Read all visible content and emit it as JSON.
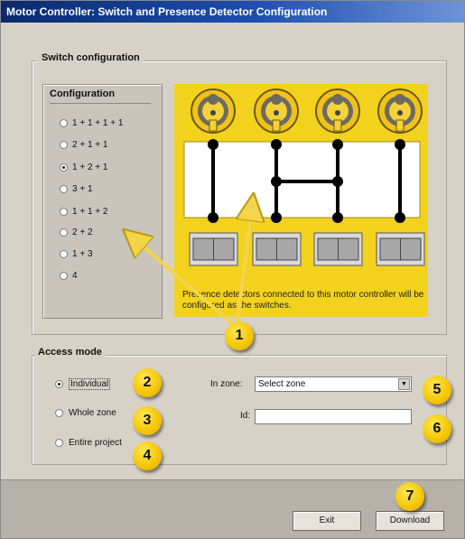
{
  "window": {
    "title": "Motor Controller: Switch and Presence Detector Configuration"
  },
  "switch_configuration": {
    "title": "Switch configuration",
    "configuration": {
      "title": "Configuration",
      "options": [
        "1 + 1 + 1 + 1",
        "2 + 1 + 1",
        "1 + 2 + 1",
        "3 + 1",
        "1 + 1 + 2",
        "2 + 2",
        "1 + 3",
        "4"
      ],
      "selected": "1 + 2 + 1"
    },
    "diagram_caption": "Presence detectors connected to this motor controller will be configured as the switches."
  },
  "access_mode": {
    "title": "Access mode",
    "options": [
      "Individual",
      "Whole zone",
      "Entire project"
    ],
    "selected": "Individual",
    "in_zone_label": "In zone:",
    "zone_select_value": "Select zone",
    "id_label": "Id:",
    "id_value": ""
  },
  "buttons": {
    "exit": "Exit",
    "download": "Download"
  },
  "callouts": [
    "1",
    "2",
    "3",
    "4",
    "5",
    "6",
    "7"
  ],
  "colors": {
    "diagram_yellow": "#f2d21d",
    "callout_yellow": "#f5c400",
    "arrow_yellow": "#f3d44a"
  }
}
